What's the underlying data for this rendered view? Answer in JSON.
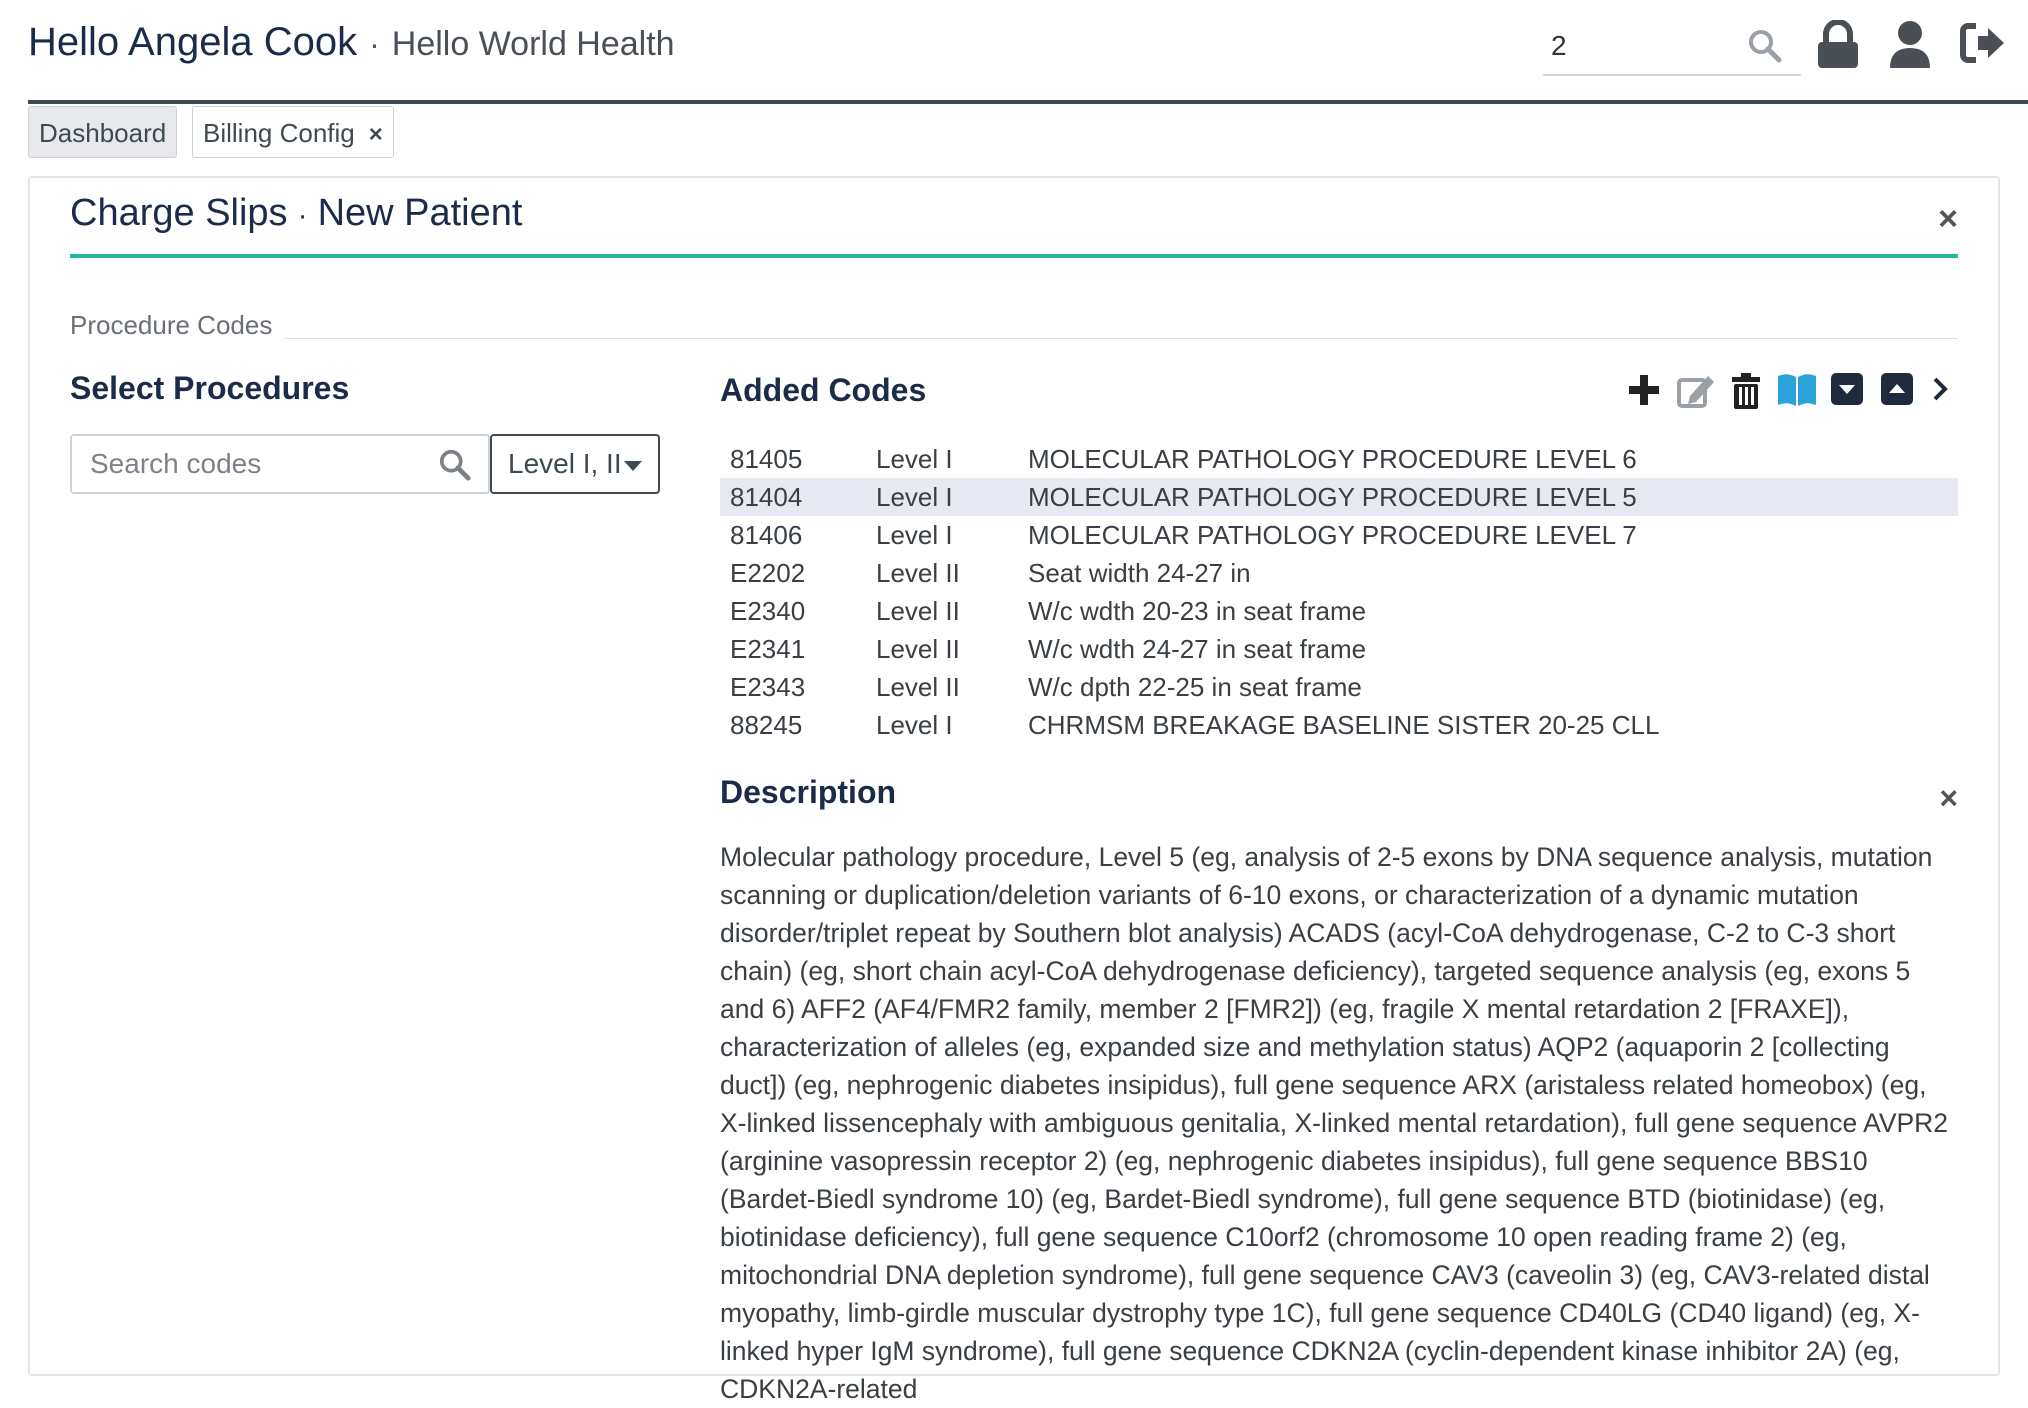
{
  "header": {
    "greeting": "Hello Angela Cook",
    "separator": "·",
    "org": "Hello World Health",
    "search_value": "2"
  },
  "tabs": [
    {
      "label": "Dashboard",
      "active": true
    },
    {
      "label": "Billing Config",
      "closable": true
    }
  ],
  "panel": {
    "title": "Charge Slips",
    "separator": "·",
    "subtitle": "New Patient",
    "close_label": "×",
    "section_label": "Procedure Codes"
  },
  "select": {
    "heading": "Select Procedures",
    "search_placeholder": "Search codes",
    "level_filter": "Level I, II"
  },
  "added": {
    "heading": "Added Codes",
    "toolbar_icons": [
      "plus-icon",
      "edit-icon",
      "trash-icon",
      "book-icon",
      "caret-down-square-icon",
      "caret-up-square-icon",
      "chevron-right-icon"
    ],
    "rows": [
      {
        "code": "81405",
        "level": "Level I",
        "desc": "MOLECULAR PATHOLOGY PROCEDURE LEVEL 6",
        "selected": false
      },
      {
        "code": "81404",
        "level": "Level I",
        "desc": "MOLECULAR PATHOLOGY PROCEDURE LEVEL 5",
        "selected": true
      },
      {
        "code": "81406",
        "level": "Level I",
        "desc": "MOLECULAR PATHOLOGY PROCEDURE LEVEL 7",
        "selected": false
      },
      {
        "code": "E2202",
        "level": "Level II",
        "desc": "Seat width 24-27 in",
        "selected": false
      },
      {
        "code": "E2340",
        "level": "Level II",
        "desc": "W/c wdth 20-23 in seat frame",
        "selected": false
      },
      {
        "code": "E2341",
        "level": "Level II",
        "desc": "W/c wdth 24-27 in seat frame",
        "selected": false
      },
      {
        "code": "E2343",
        "level": "Level II",
        "desc": "W/c dpth 22-25 in seat frame",
        "selected": false
      },
      {
        "code": "88245",
        "level": "Level I",
        "desc": "CHRMSM BREAKAGE BASELINE SISTER 20-25 CLL",
        "selected": false
      }
    ]
  },
  "description": {
    "heading": "Description",
    "close_label": "×",
    "text": "Molecular pathology procedure, Level 5 (eg, analysis of 2-5 exons by DNA sequence analysis, mutation scanning or duplication/deletion variants of 6-10 exons, or characterization of a dynamic mutation disorder/triplet repeat by Southern blot analysis) ACADS (acyl-CoA dehydrogenase, C-2 to C-3 short chain) (eg, short chain acyl-CoA dehydrogenase deficiency), targeted sequence analysis (eg, exons 5 and 6) AFF2 (AF4/FMR2 family, member 2 [FMR2]) (eg, fragile X mental retardation 2 [FRAXE]), characterization of alleles (eg, expanded size and methylation status) AQP2 (aquaporin 2 [collecting duct]) (eg, nephrogenic diabetes insipidus), full gene sequence ARX (aristaless related homeobox) (eg, X-linked lissencephaly with ambiguous genitalia, X-linked mental retardation), full gene sequence AVPR2 (arginine vasopressin receptor 2) (eg, nephrogenic diabetes insipidus), full gene sequence BBS10 (Bardet-Biedl syndrome 10) (eg, Bardet-Biedl syndrome), full gene sequence BTD (biotinidase) (eg, biotinidase deficiency), full gene sequence C10orf2 (chromosome 10 open reading frame 2) (eg, mitochondrial DNA depletion syndrome), full gene sequence CAV3 (caveolin 3) (eg, CAV3-related distal myopathy, limb-girdle muscular dystrophy type 1C), full gene sequence CD40LG (CD40 ligand) (eg, X-linked hyper IgM syndrome), full gene sequence CDKN2A (cyclin-dependent kinase inhibitor 2A) (eg, CDKN2A-related"
  }
}
